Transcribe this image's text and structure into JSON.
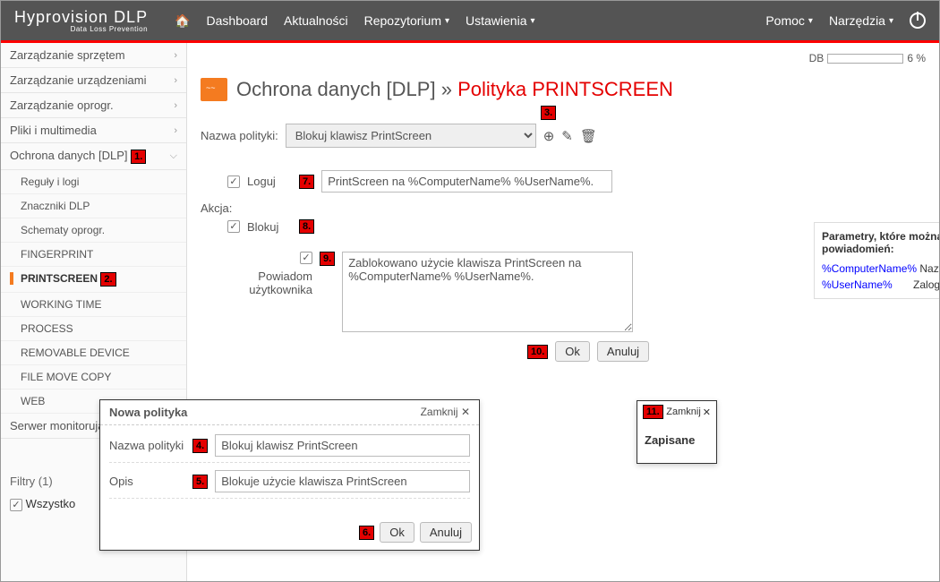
{
  "brand": {
    "name": "Hyprovision",
    "suffix": "DLP",
    "sub": "Data Loss Prevention"
  },
  "nav": {
    "dashboard": "Dashboard",
    "news": "Aktualności",
    "repo": "Repozytorium",
    "settings": "Ustawienia",
    "help": "Pomoc",
    "tools": "Narzędzia"
  },
  "db": {
    "label": "DB",
    "pct": "6 %"
  },
  "sidebar": {
    "groups": [
      {
        "label": "Zarządzanie sprzętem"
      },
      {
        "label": "Zarządzanie urządzeniami"
      },
      {
        "label": "Zarządzanie oprogr."
      },
      {
        "label": "Pliki i multimedia"
      },
      {
        "label": "Ochrona danych [DLP]"
      },
      {
        "label": "Serwer monitorujący"
      }
    ],
    "dlp_items": [
      {
        "label": "Reguły i logi"
      },
      {
        "label": "Znaczniki DLP"
      },
      {
        "label": "Schematy oprogr."
      },
      {
        "label": "FINGERPRINT"
      },
      {
        "label": "PRINTSCREEN"
      },
      {
        "label": "WORKING TIME"
      },
      {
        "label": "PROCESS"
      },
      {
        "label": "REMOVABLE DEVICE"
      },
      {
        "label": "FILE MOVE COPY"
      },
      {
        "label": "WEB"
      }
    ],
    "filters": {
      "title": "Filtry (1)",
      "all": "Wszystko"
    }
  },
  "page": {
    "title_main": "Ochrona danych [DLP]",
    "title_sep": "»",
    "title_red": "Polityka PRINTSCREEN",
    "policy_name_label": "Nazwa polityki:",
    "policy_name_value": "Blokuj klawisz PrintScreen",
    "action_label": "Akcja:",
    "log_label": "Loguj",
    "log_text": "PrintScreen na %ComputerName% %UserName%.",
    "block_label": "Blokuj",
    "notify_label": "Powiadom użytkownika",
    "notify_text": "Zablokowano użycie klawisza PrintScreen na %ComputerName% %UserName%.",
    "ok": "Ok",
    "cancel": "Anuluj"
  },
  "params": {
    "title": "Parametry, które można użyć w treści logów / powiadomień:",
    "p1_name": "%ComputerName%",
    "p1_desc": "Nazwa komputera",
    "p2_name": "%UserName%",
    "p2_desc": "Zalogowany użytkownik"
  },
  "modal": {
    "title": "Nowa polityka",
    "close": "Zamknij",
    "name_label": "Nazwa polityki",
    "name_value": "Blokuj klawisz PrintScreen",
    "desc_label": "Opis",
    "desc_value": "Blokuje użycie klawisza PrintScreen",
    "ok": "Ok",
    "cancel": "Anuluj"
  },
  "toast": {
    "close": "Zamknij",
    "body": "Zapisane"
  },
  "annot": {
    "a1": "1.",
    "a2": "2.",
    "a3": "3.",
    "a4": "4.",
    "a5": "5.",
    "a6": "6.",
    "a7": "7.",
    "a8": "8.",
    "a9": "9.",
    "a10": "10.",
    "a11": "11."
  }
}
